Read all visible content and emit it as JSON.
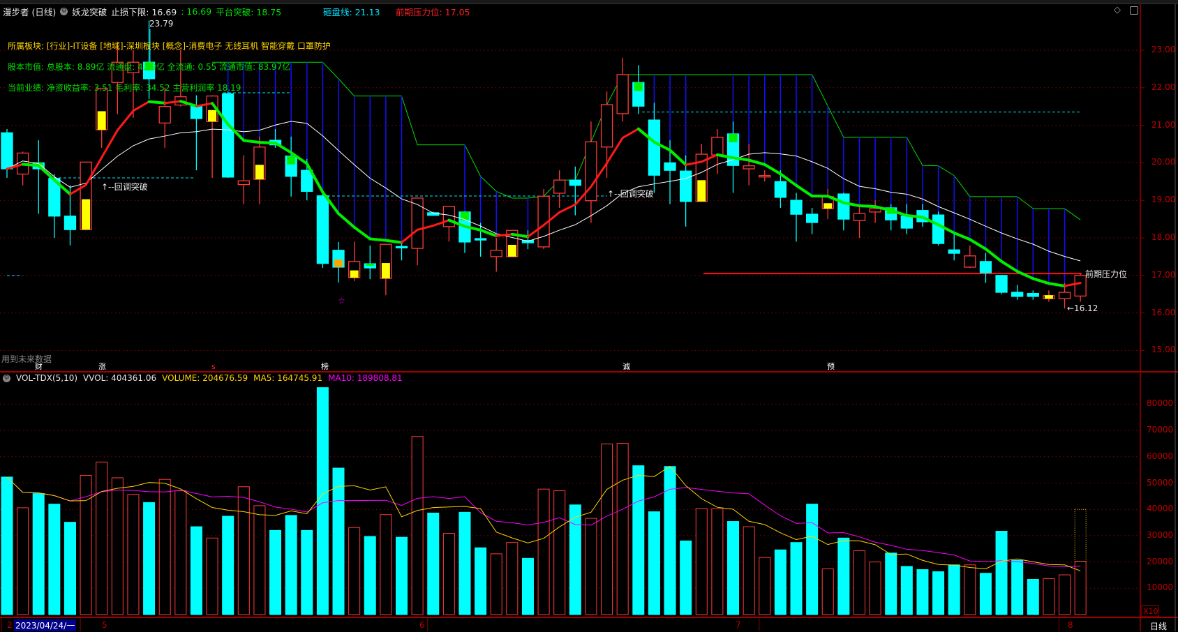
{
  "header": {
    "stock": "漫步者 (日线)",
    "indicator": "妖龙突破",
    "stop_loss": "止损下限: 16.69",
    "stop_loss2": ": 16.69",
    "platform": "平台突破: 18.75",
    "dump_line": "砸盘线: 21.13",
    "prev_pressure": "前期压力位: 17.05"
  },
  "info": {
    "sector": "所属板块: [行业]-IT设备 [地域]-深圳板块 [概念]-消费电子 无线耳机 智能穿戴 口罩防护",
    "capital": "股本市值: 总股本: 8.89亿 流通盘: 4.99亿 全流通: 0.55 流通市值: 83.97亿",
    "performance": "当前业绩:  净资收益率: 3.51 毛利率: 34.52 主营利润率 18.19"
  },
  "annotations": {
    "high_label": "23.79",
    "low_label": "←16.12",
    "pullback1": "↑--回调突破",
    "pullback2": "↑--回调突破",
    "pressure_label": "前期压力位",
    "future_data": "用到未来数据",
    "star": "☆"
  },
  "tags": [
    {
      "text": "财",
      "bg": "#1a4fa0"
    },
    {
      "text": "涨",
      "bg": "#8b0000"
    },
    {
      "text": "s",
      "bg": "transparent"
    },
    {
      "text": "榜",
      "bg": "#b85c00"
    },
    {
      "text": "诚",
      "bg": "#0a7a0a"
    },
    {
      "text": "预",
      "bg": "#b85c00"
    }
  ],
  "volume_header": {
    "name": "VOL-TDX(5,10)",
    "vvol": "VVOL: 404361.06",
    "volume": "VOLUME: 204676.59",
    "ma5": "MA5: 164745.91",
    "ma10": "MA10: 189808.81"
  },
  "axis": {
    "price_ticks": [
      "23.00",
      "22.00",
      "21.00",
      "20.00",
      "19.00",
      "18.00",
      "17.00",
      "16.00",
      "15.00"
    ],
    "volume_ticks": [
      "80000",
      "70000",
      "60000",
      "50000",
      "40000",
      "30000",
      "20000",
      "10000"
    ],
    "volume_unit": "X10",
    "period": "日线"
  },
  "dates": {
    "current": "2023/04/24/一",
    "first": "2",
    "months": [
      "5",
      "6",
      "7",
      "8"
    ]
  },
  "colors": {
    "up": "#ff3b3b",
    "down": "#00ffff",
    "ma5": "#ffd400",
    "ma10": "#ff00ff",
    "grid": "#8b0000"
  },
  "chart_data": {
    "type": "candlestick",
    "title": "漫步者 (日线)",
    "price_range": [
      14.6,
      23.9
    ],
    "volume_range": [
      0,
      90000
    ],
    "open": [
      20.8,
      19.7,
      20.0,
      19.58,
      18.58,
      18.22,
      20.88,
      22.14,
      22.4,
      22.68,
      21.06,
      21.54,
      21.5,
      21.1,
      21.84,
      19.42,
      19.56,
      20.6,
      20.18,
      19.8,
      19.12,
      17.67,
      16.94,
      17.31,
      16.92,
      17.77,
      17.72,
      18.67,
      18.3,
      18.69,
      17.98,
      17.5,
      17.5,
      17.93,
      17.76,
      19.19,
      19.54,
      18.99,
      20.42,
      21.31,
      22.14,
      21.14,
      20.0,
      19.78,
      18.97,
      20.21,
      20.77,
      19.84,
      19.65,
      19.5,
      19.0,
      18.63,
      18.78,
      19.17,
      18.46,
      18.69,
      18.8,
      18.58,
      18.73,
      18.61,
      17.68,
      17.22,
      17.37,
      17.0,
      16.55,
      16.52,
      16.38,
      16.38,
      16.45
    ],
    "high": [
      20.9,
      20.3,
      20.6,
      19.7,
      19.4,
      20.02,
      21.98,
      23.2,
      23.0,
      23.79,
      22.0,
      23.0,
      21.8,
      21.8,
      21.9,
      20.2,
      20.7,
      20.9,
      20.7,
      20.1,
      19.2,
      17.89,
      17.9,
      17.8,
      17.83,
      17.9,
      19.06,
      18.7,
      18.84,
      18.7,
      18.4,
      18.0,
      18.2,
      18.2,
      19.3,
      19.8,
      19.9,
      21.1,
      21.9,
      22.8,
      22.6,
      21.6,
      20.6,
      20.2,
      20.5,
      20.9,
      21.1,
      20.5,
      19.8,
      19.8,
      19.2,
      18.8,
      19.3,
      19.2,
      18.9,
      19.0,
      18.9,
      18.9,
      18.9,
      18.7,
      18.1,
      17.8,
      17.6,
      17.0,
      16.75,
      16.6,
      16.6,
      16.8,
      17.05
    ],
    "low": [
      19.6,
      19.4,
      18.64,
      18.0,
      17.8,
      18.2,
      20.4,
      21.3,
      21.2,
      21.7,
      20.4,
      21.5,
      19.8,
      19.6,
      19.6,
      18.9,
      18.9,
      20.4,
      19.1,
      19.0,
      17.2,
      16.81,
      16.85,
      16.9,
      16.47,
      17.4,
      17.27,
      18.6,
      17.9,
      17.6,
      17.5,
      17.1,
      17.5,
      17.7,
      17.7,
      18.8,
      18.6,
      18.4,
      19.6,
      21.1,
      21.3,
      19.2,
      18.9,
      18.3,
      18.97,
      19.7,
      19.2,
      19.4,
      19.5,
      18.8,
      17.9,
      18.1,
      18.5,
      18.2,
      18.0,
      18.4,
      18.2,
      18.1,
      18.3,
      17.8,
      17.4,
      17.2,
      16.8,
      16.5,
      16.35,
      16.35,
      16.3,
      16.12,
      16.3
    ],
    "close": [
      19.84,
      20.26,
      19.84,
      18.58,
      18.22,
      20.02,
      21.98,
      22.68,
      22.68,
      22.24,
      21.5,
      21.76,
      21.18,
      21.78,
      19.62,
      19.52,
      20.42,
      20.48,
      19.64,
      19.24,
      17.32,
      17.22,
      17.37,
      17.2,
      17.83,
      17.74,
      19.06,
      18.6,
      18.84,
      17.89,
      17.96,
      17.67,
      18.2,
      17.87,
      19.11,
      19.54,
      19.4,
      20.56,
      21.55,
      22.35,
      21.51,
      19.67,
      19.8,
      18.97,
      20.23,
      20.68,
      19.93,
      19.92,
      19.66,
      19.08,
      18.63,
      18.41,
      19.1,
      18.5,
      18.65,
      18.78,
      18.48,
      18.26,
      18.43,
      17.85,
      17.59,
      17.52,
      17.07,
      16.55,
      16.44,
      16.44,
      16.46,
      16.55,
      17.0
    ],
    "volume": [
      52300,
      40600,
      46000,
      42000,
      35100,
      52900,
      58000,
      52000,
      45700,
      42600,
      51400,
      47100,
      33400,
      29100,
      37400,
      48600,
      41400,
      32000,
      37700,
      32000,
      86300,
      55700,
      33100,
      29700,
      38000,
      29400,
      67700,
      38600,
      30900,
      38900,
      25400,
      23100,
      27400,
      21400,
      47700,
      47100,
      41700,
      36600,
      64900,
      65100,
      56600,
      39100,
      56300,
      28000,
      40300,
      40300,
      35400,
      33400,
      21700,
      24600,
      27400,
      42000,
      17400,
      29100,
      24300,
      20000,
      23400,
      18300,
      17100,
      16300,
      18900,
      18900,
      15700,
      31700,
      20600,
      13400,
      13700,
      15100,
      20300
    ],
    "highlight": [
      "",
      "",
      "g",
      "",
      "",
      "y",
      "y",
      "",
      "",
      "g",
      "",
      "",
      "",
      "y",
      "",
      "",
      "y",
      "",
      "g",
      "",
      "",
      "o",
      "y",
      "g",
      "y",
      "",
      "",
      "",
      "",
      "g",
      "",
      "",
      "y",
      "",
      "",
      "",
      "",
      "",
      "",
      "",
      "g",
      "",
      "",
      "",
      "y",
      "",
      "g",
      "",
      "",
      "",
      "",
      "",
      "y",
      "",
      "",
      "",
      "g",
      "",
      "",
      "",
      "",
      "",
      "",
      "",
      "",
      "",
      "y",
      "",
      ""
    ],
    "levels": {
      "platform_break": 18.75,
      "dump_line": 21.13,
      "prev_pressure": 17.05,
      "stop_loss": 16.69,
      "period_high": 23.79,
      "period_low": 16.12
    }
  }
}
